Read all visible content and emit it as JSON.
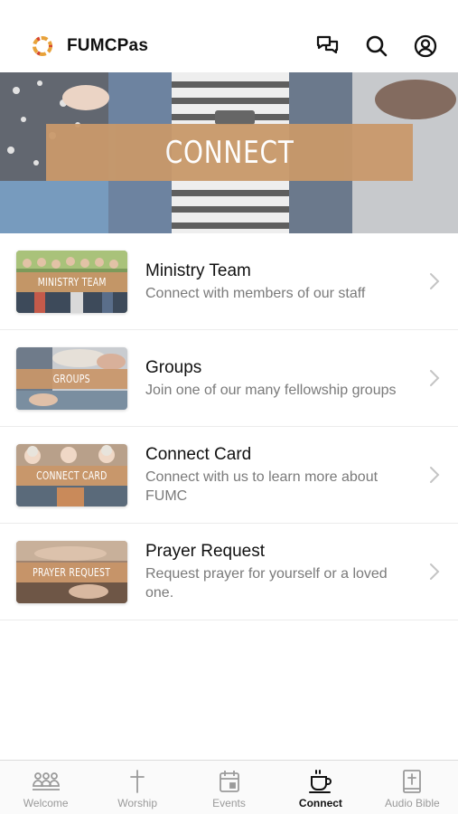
{
  "header": {
    "app_title": "FUMCPas",
    "icons": [
      "chat-icon",
      "search-icon",
      "profile-icon"
    ]
  },
  "hero": {
    "banner_text": "CONNECT"
  },
  "list": [
    {
      "title": "Ministry Team",
      "subtitle": "Connect with members of our staff",
      "thumb_label": "MINISTRY TEAM"
    },
    {
      "title": "Groups",
      "subtitle": "Join one of our many fellowship groups",
      "thumb_label": "GROUPS"
    },
    {
      "title": "Connect Card",
      "subtitle": "Connect with us to learn more about FUMC",
      "thumb_label": "CONNECT CARD"
    },
    {
      "title": "Prayer Request",
      "subtitle": "Request prayer for yourself or a loved one.",
      "thumb_label": "PRAYER REQUEST"
    }
  ],
  "tabs": [
    {
      "label": "Welcome",
      "icon": "people-icon",
      "active": false
    },
    {
      "label": "Worship",
      "icon": "cross-icon",
      "active": false
    },
    {
      "label": "Events",
      "icon": "calendar-icon",
      "active": false
    },
    {
      "label": "Connect",
      "icon": "coffee-cup-icon",
      "active": true
    },
    {
      "label": "Audio Bible",
      "icon": "bible-icon",
      "active": false
    }
  ],
  "colors": {
    "accent_tan": "#c9996a",
    "text_primary": "#111111",
    "text_secondary": "#7a7a7a",
    "tab_inactive": "#9a9a9a"
  }
}
